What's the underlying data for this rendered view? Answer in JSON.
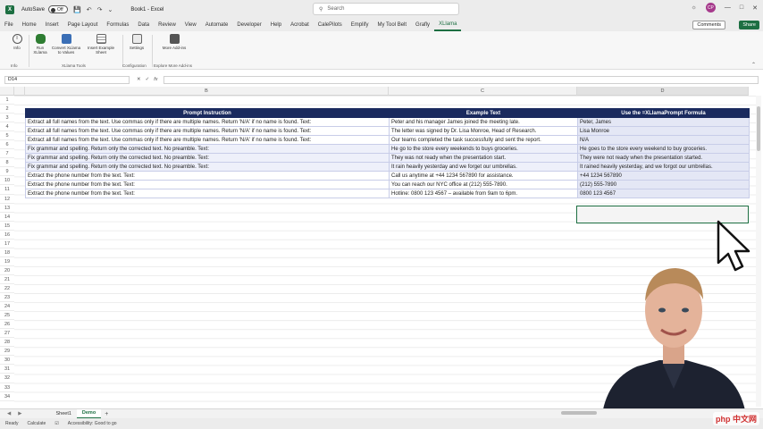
{
  "titlebar": {
    "autosave_label": "AutoSave",
    "autosave_state": "Off",
    "file_title": "Book1 - Excel",
    "search_placeholder": "Search",
    "user_initials": "CP"
  },
  "tabs": [
    "File",
    "Home",
    "Insert",
    "Page Layout",
    "Formulas",
    "Data",
    "Review",
    "View",
    "Automate",
    "Developer",
    "Help",
    "Acrobat",
    "CalePilots",
    "Emplify",
    "My Tool Belt",
    "Grafly",
    "XLlama"
  ],
  "active_tab": "XLlama",
  "comments_label": "Comments",
  "share_label": "Share",
  "ribbon": {
    "info_label": "Info",
    "run_label": "Run XLlama",
    "convert_label": "Convert XLlama to Values",
    "insert_label": "Insert Example Sheet",
    "settings_label": "Settings",
    "more_addins_label": "More Add-ins",
    "group_info": "Info",
    "group_xllama_tools": "XLlama Tools",
    "group_config": "Configuration",
    "group_explore": "Explore More Add-ins"
  },
  "formula_bar": {
    "name_box": "D14",
    "fx": "fx"
  },
  "columns": [
    "B",
    "C",
    "D"
  ],
  "table": {
    "headers": [
      "Prompt Instruction",
      "Example Text",
      "Use the =XLlamaPrompt Formula"
    ],
    "rows": [
      {
        "group": "grp1",
        "cells": [
          "Extract all full names from the text. Use commas only if there are multiple names. Return 'N/A' if no name is found. Text:",
          "Peter and his manager James joined the meeting late.",
          "Peter, James"
        ]
      },
      {
        "group": "grp1",
        "cells": [
          "Extract all full names from the text. Use commas only if there are multiple names. Return 'N/A' if no name is found. Text:",
          "The letter was signed by Dr. Lisa Monroe, Head of Research.",
          "Lisa Monroe"
        ]
      },
      {
        "group": "grp1",
        "cells": [
          "Extract all full names from the text. Use commas only if there are multiple names. Return 'N/A' if no name is found. Text:",
          "Our teams completed the task successfully and sent the report.",
          "N/A"
        ]
      },
      {
        "group": "grp2",
        "cells": [
          "Fix grammar and spelling. Return only the corrected text. No preamble. Text:",
          "He go to the store every weekends to buys groceries.",
          "He goes to the store every weekend to buy groceries."
        ]
      },
      {
        "group": "grp2",
        "cells": [
          "Fix grammar and spelling. Return only the corrected text. No preamble. Text:",
          "They was not ready when the presentation start.",
          "They were not ready when the presentation started."
        ]
      },
      {
        "group": "grp2",
        "cells": [
          "Fix grammar and spelling. Return only the corrected text. No preamble. Text:",
          "It rain heavily yesterday and we forget our umbrellas.",
          "It rained heavily yesterday, and we forgot our umbrellas."
        ]
      },
      {
        "group": "grp3",
        "cells": [
          "Extract the phone number from the text. Text:",
          "Call us anytime at +44 1234 567890 for assistance.",
          "+44 1234 567890"
        ]
      },
      {
        "group": "grp3",
        "cells": [
          "Extract the phone number from the text. Text:",
          "You can reach our NYC office at (212) 555-7890.",
          "(212) 555-7890"
        ]
      },
      {
        "group": "grp3",
        "cells": [
          "Extract the phone number from the text. Text:",
          "Hotline: 0800 123 4567 – available from 9am to 6pm.",
          "0800 123 4567"
        ]
      }
    ]
  },
  "row_numbers": [
    "1",
    "2",
    "3",
    "4",
    "5",
    "6",
    "7",
    "8",
    "9",
    "10",
    "11",
    "12",
    "13",
    "14",
    "15",
    "16",
    "17",
    "18",
    "19",
    "20",
    "21",
    "22",
    "23",
    "24",
    "25",
    "26",
    "27",
    "28",
    "29",
    "30",
    "31",
    "32",
    "33",
    "34"
  ],
  "sheets": [
    "Sheet1",
    "Demo"
  ],
  "active_sheet": "Demo",
  "status": {
    "ready": "Ready",
    "calculate": "Calculate",
    "accessibility": "Accessibility: Good to go"
  },
  "watermark": "php 中文网",
  "colors": {
    "excel_green": "#1d6f42",
    "header_navy": "#1a2a5e"
  }
}
